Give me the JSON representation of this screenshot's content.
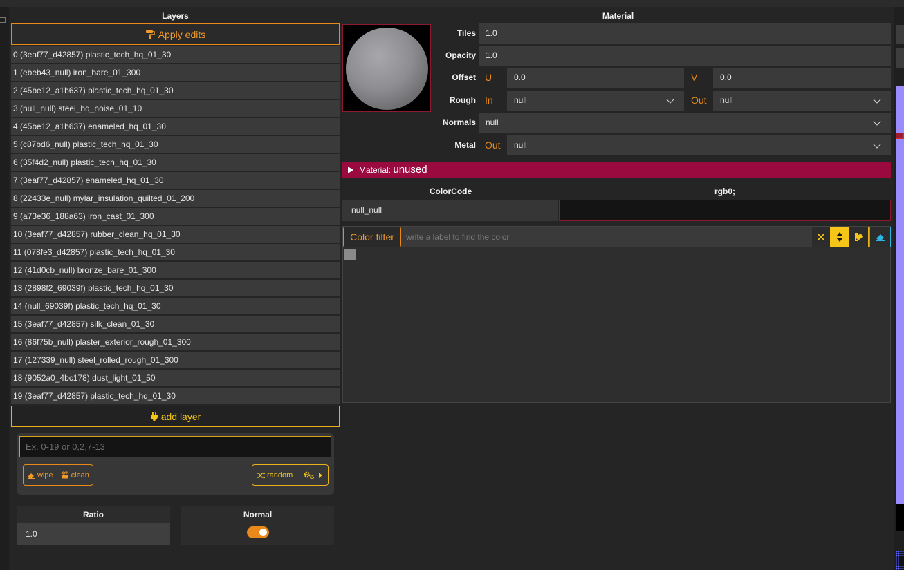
{
  "layers_panel": {
    "title": "Layers",
    "apply_label": "Apply edits",
    "items": [
      "0 (3eaf77_d42857) plastic_tech_hq_01_30",
      "1 (ebeb43_null) iron_bare_01_300",
      "2 (45be12_a1b637) plastic_tech_hq_01_30",
      "3 (null_null) steel_hq_noise_01_10",
      "4 (45be12_a1b637) enameled_hq_01_30",
      "5 (c87bd6_null) plastic_tech_hq_01_30",
      "6 (35f4d2_null) plastic_tech_hq_01_30",
      "7 (3eaf77_d42857) enameled_hq_01_30",
      "8 (22433e_null) mylar_insulation_quilted_01_200",
      "9 (a73e36_188a63) iron_cast_01_300",
      "10 (3eaf77_d42857) rubber_clean_hq_01_30",
      "11 (078fe3_d42857) plastic_tech_hq_01_30",
      "12 (41d0cb_null) bronze_bare_01_300",
      "13 (2898f2_69039f) plastic_tech_hq_01_30",
      "14 (null_69039f) plastic_tech_hq_01_30",
      "15 (3eaf77_d42857) silk_clean_01_30",
      "16 (86f75b_null) plaster_exterior_rough_01_300",
      "17 (127339_null) steel_rolled_rough_01_300",
      "18 (9052a0_4bc178) dust_light_01_50",
      "19 (3eaf77_d42857) plastic_tech_hq_01_30"
    ],
    "add_label": "add layer",
    "range_placeholder": "Ex. 0-19 or 0,2,7-13",
    "wipe_label": "wipe",
    "clean_label": "clean",
    "random_label": "random",
    "ratio_label": "Ratio",
    "ratio_value": "1.0",
    "normal_label": "Normal",
    "normal_enabled": true
  },
  "material_panel": {
    "title": "Material",
    "tiles_label": "Tiles",
    "tiles_value": "1.0",
    "opacity_label": "Opacity",
    "opacity_value": "1.0",
    "offset_label": "Offset",
    "offset_u_tag": "U",
    "offset_u_value": "0.0",
    "offset_v_tag": "V",
    "offset_v_value": "0.0",
    "rough_label": "Rough",
    "rough_in_tag": "In",
    "rough_in_value": "null",
    "rough_out_tag": "Out",
    "rough_out_value": "null",
    "normals_label": "Normals",
    "normals_value": "null",
    "metal_label": "Metal",
    "metal_out_tag": "Out",
    "metal_out_value": "null",
    "alert_prefix": "Material:",
    "alert_status": "unused",
    "colorcode_header": "ColorCode",
    "rgb_header": "rgb0;",
    "colorcode_value": "null_null",
    "filter_label": "Color filter",
    "filter_placeholder": "write a label to find the color"
  },
  "colors": {
    "accent_orange": "#e8891a",
    "accent_yellow": "#f5c518",
    "alert_crimson": "#9b0a3e",
    "cyan": "#2ab6e0"
  }
}
